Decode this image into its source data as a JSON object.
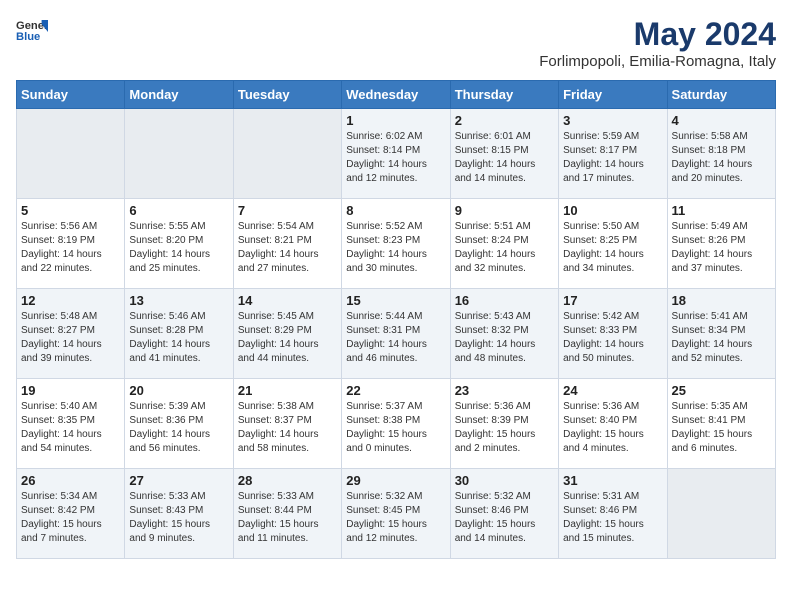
{
  "header": {
    "logo_general": "General",
    "logo_blue": "Blue",
    "title": "May 2024",
    "subtitle": "Forlimpopoli, Emilia-Romagna, Italy"
  },
  "days_of_week": [
    "Sunday",
    "Monday",
    "Tuesday",
    "Wednesday",
    "Thursday",
    "Friday",
    "Saturday"
  ],
  "weeks": [
    [
      {
        "day": null,
        "sunrise": null,
        "sunset": null,
        "daylight": null
      },
      {
        "day": null,
        "sunrise": null,
        "sunset": null,
        "daylight": null
      },
      {
        "day": null,
        "sunrise": null,
        "sunset": null,
        "daylight": null
      },
      {
        "day": "1",
        "sunrise": "Sunrise: 6:02 AM",
        "sunset": "Sunset: 8:14 PM",
        "daylight": "Daylight: 14 hours and 12 minutes."
      },
      {
        "day": "2",
        "sunrise": "Sunrise: 6:01 AM",
        "sunset": "Sunset: 8:15 PM",
        "daylight": "Daylight: 14 hours and 14 minutes."
      },
      {
        "day": "3",
        "sunrise": "Sunrise: 5:59 AM",
        "sunset": "Sunset: 8:17 PM",
        "daylight": "Daylight: 14 hours and 17 minutes."
      },
      {
        "day": "4",
        "sunrise": "Sunrise: 5:58 AM",
        "sunset": "Sunset: 8:18 PM",
        "daylight": "Daylight: 14 hours and 20 minutes."
      }
    ],
    [
      {
        "day": "5",
        "sunrise": "Sunrise: 5:56 AM",
        "sunset": "Sunset: 8:19 PM",
        "daylight": "Daylight: 14 hours and 22 minutes."
      },
      {
        "day": "6",
        "sunrise": "Sunrise: 5:55 AM",
        "sunset": "Sunset: 8:20 PM",
        "daylight": "Daylight: 14 hours and 25 minutes."
      },
      {
        "day": "7",
        "sunrise": "Sunrise: 5:54 AM",
        "sunset": "Sunset: 8:21 PM",
        "daylight": "Daylight: 14 hours and 27 minutes."
      },
      {
        "day": "8",
        "sunrise": "Sunrise: 5:52 AM",
        "sunset": "Sunset: 8:23 PM",
        "daylight": "Daylight: 14 hours and 30 minutes."
      },
      {
        "day": "9",
        "sunrise": "Sunrise: 5:51 AM",
        "sunset": "Sunset: 8:24 PM",
        "daylight": "Daylight: 14 hours and 32 minutes."
      },
      {
        "day": "10",
        "sunrise": "Sunrise: 5:50 AM",
        "sunset": "Sunset: 8:25 PM",
        "daylight": "Daylight: 14 hours and 34 minutes."
      },
      {
        "day": "11",
        "sunrise": "Sunrise: 5:49 AM",
        "sunset": "Sunset: 8:26 PM",
        "daylight": "Daylight: 14 hours and 37 minutes."
      }
    ],
    [
      {
        "day": "12",
        "sunrise": "Sunrise: 5:48 AM",
        "sunset": "Sunset: 8:27 PM",
        "daylight": "Daylight: 14 hours and 39 minutes."
      },
      {
        "day": "13",
        "sunrise": "Sunrise: 5:46 AM",
        "sunset": "Sunset: 8:28 PM",
        "daylight": "Daylight: 14 hours and 41 minutes."
      },
      {
        "day": "14",
        "sunrise": "Sunrise: 5:45 AM",
        "sunset": "Sunset: 8:29 PM",
        "daylight": "Daylight: 14 hours and 44 minutes."
      },
      {
        "day": "15",
        "sunrise": "Sunrise: 5:44 AM",
        "sunset": "Sunset: 8:31 PM",
        "daylight": "Daylight: 14 hours and 46 minutes."
      },
      {
        "day": "16",
        "sunrise": "Sunrise: 5:43 AM",
        "sunset": "Sunset: 8:32 PM",
        "daylight": "Daylight: 14 hours and 48 minutes."
      },
      {
        "day": "17",
        "sunrise": "Sunrise: 5:42 AM",
        "sunset": "Sunset: 8:33 PM",
        "daylight": "Daylight: 14 hours and 50 minutes."
      },
      {
        "day": "18",
        "sunrise": "Sunrise: 5:41 AM",
        "sunset": "Sunset: 8:34 PM",
        "daylight": "Daylight: 14 hours and 52 minutes."
      }
    ],
    [
      {
        "day": "19",
        "sunrise": "Sunrise: 5:40 AM",
        "sunset": "Sunset: 8:35 PM",
        "daylight": "Daylight: 14 hours and 54 minutes."
      },
      {
        "day": "20",
        "sunrise": "Sunrise: 5:39 AM",
        "sunset": "Sunset: 8:36 PM",
        "daylight": "Daylight: 14 hours and 56 minutes."
      },
      {
        "day": "21",
        "sunrise": "Sunrise: 5:38 AM",
        "sunset": "Sunset: 8:37 PM",
        "daylight": "Daylight: 14 hours and 58 minutes."
      },
      {
        "day": "22",
        "sunrise": "Sunrise: 5:37 AM",
        "sunset": "Sunset: 8:38 PM",
        "daylight": "Daylight: 15 hours and 0 minutes."
      },
      {
        "day": "23",
        "sunrise": "Sunrise: 5:36 AM",
        "sunset": "Sunset: 8:39 PM",
        "daylight": "Daylight: 15 hours and 2 minutes."
      },
      {
        "day": "24",
        "sunrise": "Sunrise: 5:36 AM",
        "sunset": "Sunset: 8:40 PM",
        "daylight": "Daylight: 15 hours and 4 minutes."
      },
      {
        "day": "25",
        "sunrise": "Sunrise: 5:35 AM",
        "sunset": "Sunset: 8:41 PM",
        "daylight": "Daylight: 15 hours and 6 minutes."
      }
    ],
    [
      {
        "day": "26",
        "sunrise": "Sunrise: 5:34 AM",
        "sunset": "Sunset: 8:42 PM",
        "daylight": "Daylight: 15 hours and 7 minutes."
      },
      {
        "day": "27",
        "sunrise": "Sunrise: 5:33 AM",
        "sunset": "Sunset: 8:43 PM",
        "daylight": "Daylight: 15 hours and 9 minutes."
      },
      {
        "day": "28",
        "sunrise": "Sunrise: 5:33 AM",
        "sunset": "Sunset: 8:44 PM",
        "daylight": "Daylight: 15 hours and 11 minutes."
      },
      {
        "day": "29",
        "sunrise": "Sunrise: 5:32 AM",
        "sunset": "Sunset: 8:45 PM",
        "daylight": "Daylight: 15 hours and 12 minutes."
      },
      {
        "day": "30",
        "sunrise": "Sunrise: 5:32 AM",
        "sunset": "Sunset: 8:46 PM",
        "daylight": "Daylight: 15 hours and 14 minutes."
      },
      {
        "day": "31",
        "sunrise": "Sunrise: 5:31 AM",
        "sunset": "Sunset: 8:46 PM",
        "daylight": "Daylight: 15 hours and 15 minutes."
      },
      {
        "day": null,
        "sunrise": null,
        "sunset": null,
        "daylight": null
      }
    ]
  ]
}
